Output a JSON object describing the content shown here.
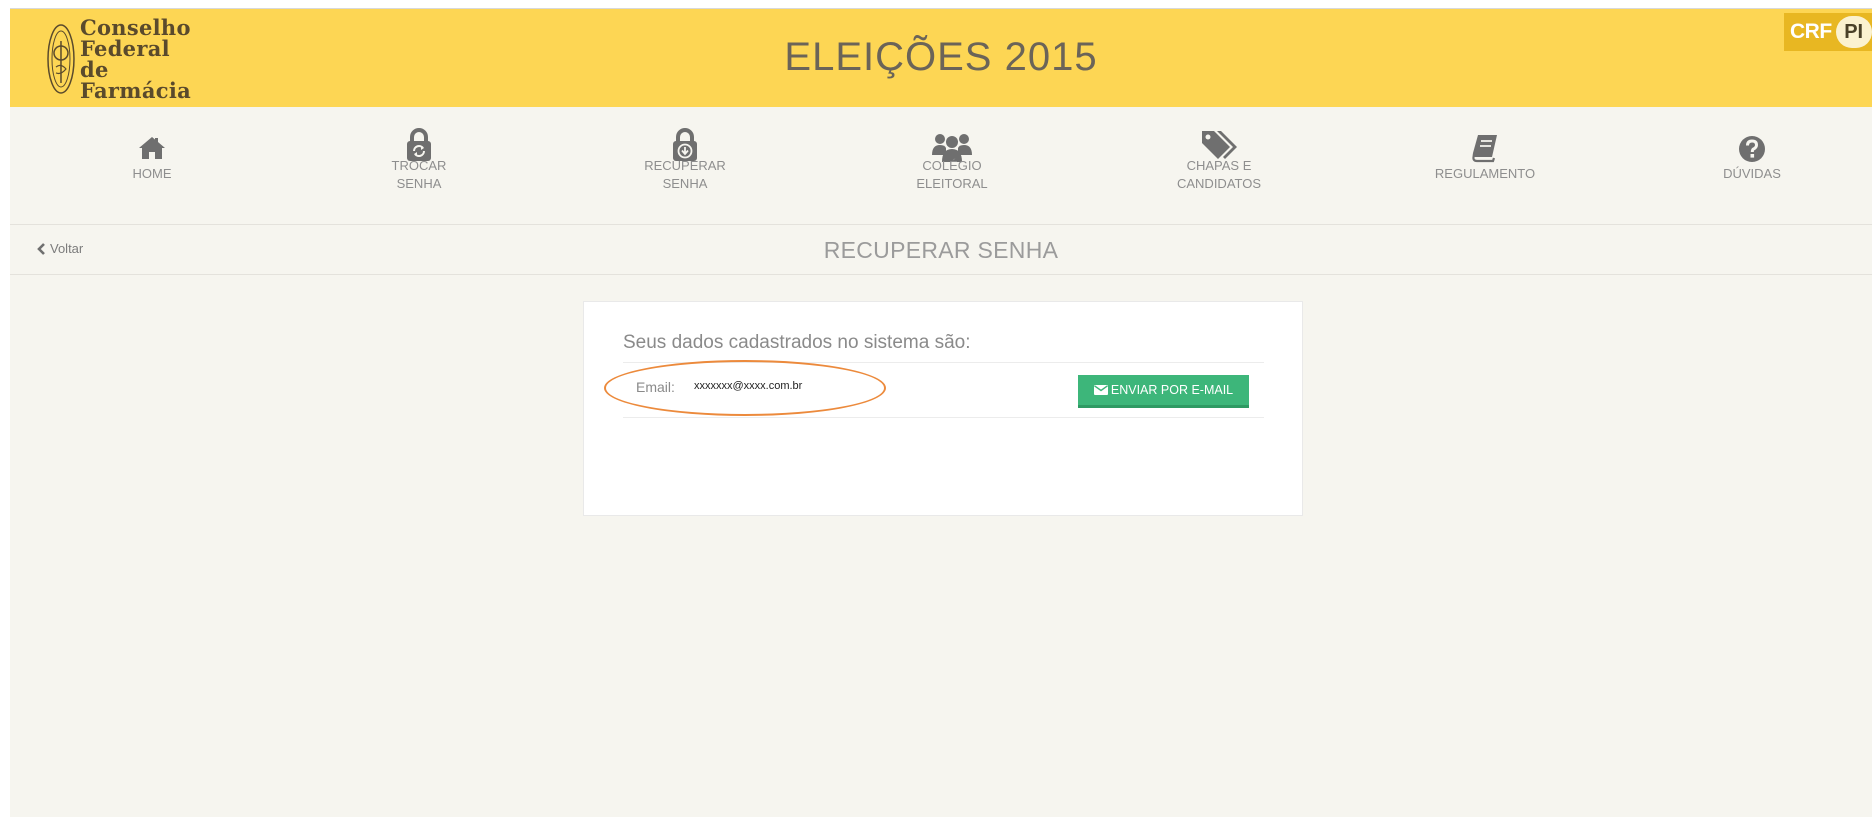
{
  "header": {
    "logo_lines": [
      "Conselho",
      "Federal de",
      "Farmácia"
    ],
    "title": "ELEIÇÕES 2015",
    "badge_left": "CRF",
    "badge_right": "PI"
  },
  "nav": {
    "items": [
      {
        "icon": "home-icon",
        "line1": "HOME",
        "line2": ""
      },
      {
        "icon": "lock-refresh-icon",
        "line1": "TROCAR",
        "line2": "SENHA"
      },
      {
        "icon": "lock-download-icon",
        "line1": "RECUPERAR",
        "line2": "SENHA"
      },
      {
        "icon": "users-icon",
        "line1": "COLÉGIO",
        "line2": "ELEITORAL"
      },
      {
        "icon": "tags-icon",
        "line1": "CHAPAS E",
        "line2": "CANDIDATOS"
      },
      {
        "icon": "book-icon",
        "line1": "REGULAMENTO",
        "line2": ""
      },
      {
        "icon": "question-circle-icon",
        "line1": "DÚVIDAS",
        "line2": ""
      }
    ]
  },
  "subbar": {
    "back_label": "Voltar",
    "page_title": "RECUPERAR SENHA"
  },
  "card": {
    "heading": "Seus dados cadastrados no sistema são:",
    "email_label": "Email:",
    "email_value": "xxxxxxx@xxxx.com.br",
    "send_button": "ENVIAR POR E-MAIL"
  },
  "colors": {
    "header_bg": "#fdd654",
    "page_bg": "#f6f5ef",
    "button_green": "#3db67a",
    "highlight_orange": "#ec8a3c",
    "badge_gold": "#e8b722"
  }
}
